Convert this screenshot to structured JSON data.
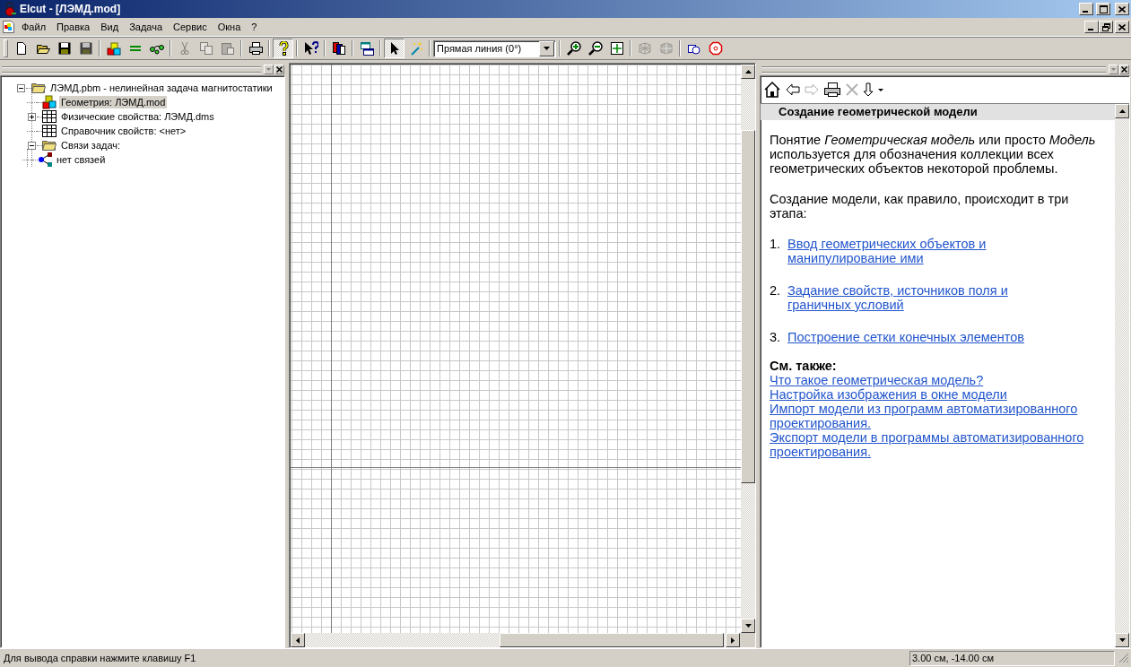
{
  "window": {
    "title": "Elcut - [ЛЭМД.mod]"
  },
  "menu": [
    "Файл",
    "Правка",
    "Вид",
    "Задача",
    "Сервис",
    "Окна",
    "?"
  ],
  "toolbar": [
    [
      {
        "kind": "button",
        "disabled": false,
        "pressed": false
      },
      {
        "kind": "button",
        "disabled": false,
        "pressed": false
      },
      {
        "kind": "button",
        "disabled": false,
        "pressed": false
      },
      {
        "kind": "button",
        "disabled": false,
        "pressed": false
      }
    ],
    [
      {
        "kind": "button",
        "disabled": false,
        "pressed": false
      },
      {
        "kind": "button",
        "disabled": false,
        "pressed": false
      },
      {
        "kind": "button",
        "disabled": false,
        "pressed": false
      }
    ],
    [
      {
        "kind": "button",
        "disabled": true,
        "pressed": false
      },
      {
        "kind": "button",
        "disabled": true,
        "pressed": false
      },
      {
        "kind": "button",
        "disabled": true,
        "pressed": false
      }
    ],
    [
      {
        "kind": "button",
        "disabled": false,
        "pressed": false
      }
    ],
    [
      {
        "kind": "button",
        "disabled": false,
        "pressed": true
      }
    ],
    [
      {
        "kind": "button",
        "disabled": false,
        "pressed": false
      }
    ],
    [
      {
        "kind": "button",
        "disabled": false,
        "pressed": false
      }
    ],
    [
      {
        "kind": "button",
        "disabled": false,
        "pressed": false
      }
    ],
    [
      {
        "kind": "button",
        "disabled": false,
        "pressed": true
      },
      {
        "kind": "button",
        "disabled": false,
        "pressed": false
      }
    ],
    [
      {
        "kind": "dropdown",
        "value": "Прямая линия (0°)"
      }
    ],
    [
      {
        "kind": "button",
        "disabled": false,
        "pressed": false
      },
      {
        "kind": "button",
        "disabled": false,
        "pressed": false
      },
      {
        "kind": "button",
        "disabled": false,
        "pressed": false
      }
    ],
    [
      {
        "kind": "button",
        "disabled": true,
        "pressed": false
      },
      {
        "kind": "button",
        "disabled": true,
        "pressed": false
      }
    ],
    [
      {
        "kind": "button",
        "disabled": false,
        "pressed": false
      },
      {
        "kind": "button",
        "disabled": false,
        "pressed": false
      }
    ]
  ],
  "project_tree": {
    "items": [
      {
        "kind": "folder",
        "label": "ЛЭМД.pbm - нелинейная задача магнитостатики",
        "selected": false,
        "expanded": true,
        "children": [
          {
            "kind": "geometry",
            "label": "Геометрия: ЛЭМД.mod",
            "selected": true
          },
          {
            "kind": "table",
            "label": "Физические свойства: ЛЭМД.dms",
            "selected": false,
            "expanded": false
          },
          {
            "kind": "table",
            "label": "Справочник свойств: <нет>",
            "selected": false
          },
          {
            "kind": "folder",
            "label": "Связи задач:",
            "selected": false,
            "expanded": true,
            "children": [
              {
                "kind": "links",
                "label": "нет связей",
                "selected": false
              }
            ]
          }
        ]
      }
    ]
  },
  "help_panel": {
    "toolbar": [
      {
        "disabled": false
      },
      {
        "disabled": false
      },
      {
        "disabled": true
      },
      {
        "disabled": false
      },
      {
        "disabled": true
      },
      {
        "disabled": false
      },
      {
        "disabled": false
      }
    ],
    "heading": "Создание геометрической модели",
    "blocks": [
      {
        "kind": "paragraph",
        "text": "Понятие *Геометрическая модель* или просто *Модель* используется для обозначения коллекции всех геометрических объектов некоторой проблемы."
      },
      {
        "kind": "paragraph",
        "text": "Создание модели, как правило, происходит в три этапа:"
      },
      {
        "kind": "steps",
        "items": [
          {
            "number": "1.",
            "link": "Ввод геометрических объектов и манипулирование ими"
          },
          {
            "number": "2.",
            "link": "Задание свойств, источников поля и граничных условий"
          },
          {
            "number": "3.",
            "link": "Построение сетки конечных элементов"
          }
        ]
      },
      {
        "kind": "see_also",
        "title": "См. также:",
        "links": [
          "Что такое геометрическая модель?",
          "Настройка изображения в окне модели",
          "Импорт модели из программ автоматизированного проектирования.",
          "Экспорт модели в программы автоматизированного проектирования."
        ]
      }
    ]
  },
  "status_bar": {
    "message": "Для вывода справки нажмите клавишу F1",
    "coordinates": "3.00 см, -14.00 см"
  }
}
